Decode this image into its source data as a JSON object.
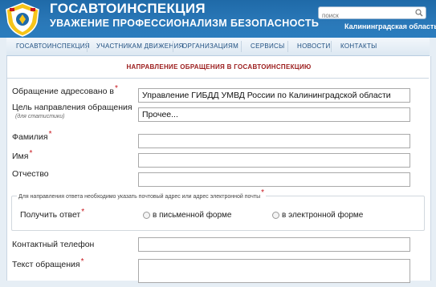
{
  "header": {
    "site_title": "ГОСАВТОИНСПЕКЦИЯ",
    "slogan": "УВАЖЕНИЕ ПРОФЕССИОНАЛИЗМ БЕЗОПАСНОСТЬ",
    "search_placeholder": "поиск",
    "region": "Калининградская область"
  },
  "nav": {
    "items": [
      "ГОСАВТОИНСПЕКЦИЯ",
      "УЧАСТНИКАМ ДВИЖЕНИЯ",
      "ОРГАНИЗАЦИЯМ",
      "СЕРВИСЫ",
      "НОВОСТИ",
      "КОНТАКТЫ"
    ]
  },
  "page": {
    "heading": "НАПРАВЛЕНИЕ ОБРАЩЕНИЯ В ГОСАВТОИНСПЕКЦИЮ"
  },
  "form": {
    "addressee_label": "Обращение адресовано в",
    "addressee_value": "Управление ГИБДД УМВД России по Калининградской области",
    "purpose_label": "Цель направления обращения",
    "purpose_sublabel": "(для статистики)",
    "purpose_value": "Прочее...",
    "surname_label": "Фамилия",
    "name_label": "Имя",
    "patronymic_label": "Отчество",
    "reply_legend": "Для направления ответа необходимо указать почтовый адрес или адрес электронной почты",
    "reply_label": "Получить ответ",
    "reply_options": [
      "в письменной форме",
      "в электронной форме"
    ],
    "phone_label": "Контактный телефон",
    "text_label": "Текст обращения",
    "required_mark": "*"
  },
  "colors": {
    "header_blue": "#2a78b8",
    "nav_text": "#1f4f80",
    "heading_red": "#9b1c1c",
    "required_red": "#c8161d"
  },
  "icons": {
    "logo": "gibdd-emblem-icon",
    "search": "search-icon"
  }
}
